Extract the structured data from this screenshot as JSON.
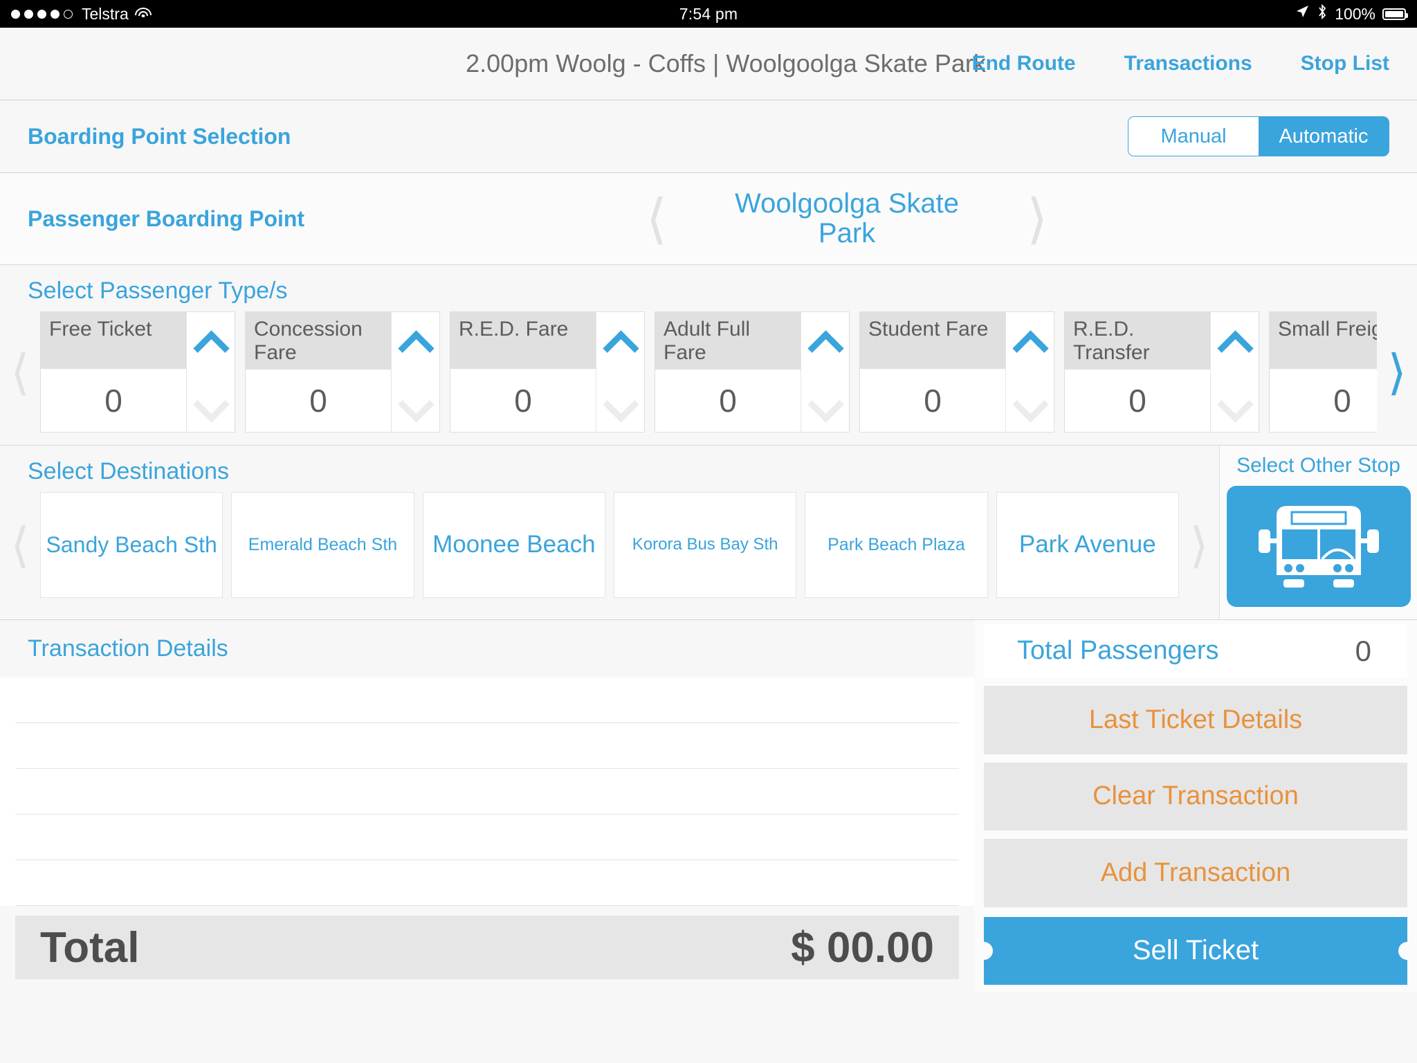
{
  "statusbar": {
    "carrier": "Telstra",
    "signal_dots_filled": 4,
    "signal_dots_total": 5,
    "wifi_icon": "wifi-icon",
    "time": "7:54 pm",
    "location_icon": "location-arrow-icon",
    "bluetooth_icon": "bluetooth-icon",
    "battery_percent": "100%",
    "battery_icon": "battery-full-icon"
  },
  "navbar": {
    "title": "2.00pm Woolg - Coffs | Woolgoolga Skate Park",
    "actions": [
      {
        "label": "End Route"
      },
      {
        "label": "Transactions"
      },
      {
        "label": "Stop List"
      }
    ]
  },
  "boarding_point_selection": {
    "title": "Boarding Point Selection",
    "mode_options": [
      {
        "label": "Manual",
        "selected": false
      },
      {
        "label": "Automatic",
        "selected": true
      }
    ]
  },
  "passenger_boarding_point": {
    "label": "Passenger Boarding Point",
    "prev_icon": "chevron-left-icon",
    "next_icon": "chevron-right-icon",
    "current_stop": "Woolgoolga Skate Park"
  },
  "passenger_types": {
    "heading": "Select Passenger Type/s",
    "prev_icon": "chevron-left-icon",
    "next_icon": "chevron-right-icon",
    "items": [
      {
        "label": "Free Ticket",
        "value": "0"
      },
      {
        "label": "Concession Fare",
        "value": "0"
      },
      {
        "label": "R.E.D. Fare",
        "value": "0"
      },
      {
        "label": "Adult Full Fare",
        "value": "0"
      },
      {
        "label": "Student Fare",
        "value": "0"
      },
      {
        "label": "R.E.D. Transfer",
        "value": "0"
      },
      {
        "label": "Small Freight",
        "value": "0"
      }
    ]
  },
  "destinations": {
    "heading": "Select Destinations",
    "prev_icon": "chevron-left-icon",
    "next_icon": "chevron-right-icon",
    "items": [
      {
        "label": "Sandy Beach Sth",
        "size": "s-md"
      },
      {
        "label": "Emerald Beach Sth",
        "size": "s-sm"
      },
      {
        "label": "Moonee Beach",
        "size": "s-lg"
      },
      {
        "label": "Korora Bus Bay Sth",
        "size": "s-xs"
      },
      {
        "label": "Park Beach Plaza",
        "size": "s-sm"
      },
      {
        "label": "Park Avenue",
        "size": "s-lg"
      }
    ]
  },
  "other_stop": {
    "title": "Select Other Stop",
    "icon": "bus-icon"
  },
  "transaction_details": {
    "heading": "Transaction Details",
    "rows": [
      "",
      "",
      "",
      "",
      ""
    ],
    "total_label": "Total",
    "total_amount": "$ 00.00"
  },
  "summary_panel": {
    "total_passengers_label": "Total Passengers",
    "total_passengers_value": "0",
    "buttons": [
      {
        "label": "Last Ticket Details"
      },
      {
        "label": "Clear Transaction"
      },
      {
        "label": "Add Transaction"
      }
    ],
    "primary_button": {
      "label": "Sell Ticket"
    }
  },
  "colors": {
    "accent_blue": "#3aa4dc",
    "accent_orange": "#e8923c",
    "text_gray": "#5c5c5c",
    "panel_gray": "#e6e6e6"
  }
}
